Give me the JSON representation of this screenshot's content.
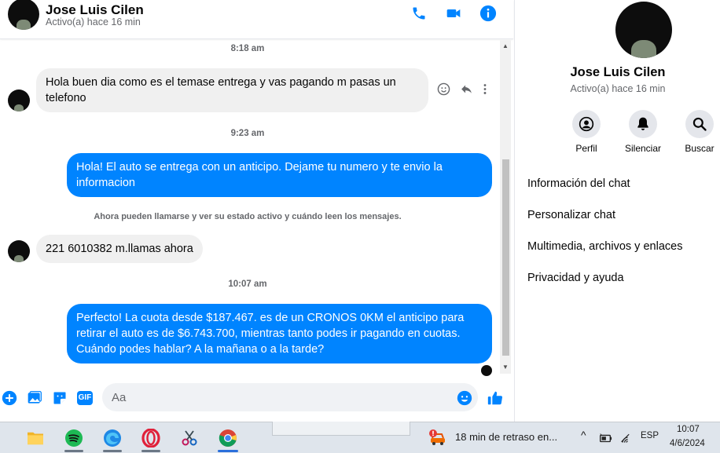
{
  "header": {
    "contact_name": "Jose Luis Cilen",
    "status": "Activo(a) hace 16 min",
    "icons": [
      "phone-icon",
      "video-icon",
      "info-icon"
    ]
  },
  "messages": {
    "ts1": "8:18 am",
    "msg1": "Hola buen dia como es el temase entrega y vas pagando m pasas un telefono",
    "ts2": "9:23 am",
    "msg2": "Hola! El auto se entrega con un anticipo. Dejame tu numero y te envio la informacion",
    "notice": "Ahora pueden llamarse y ver su estado activo y cuándo leen los mensajes.",
    "msg3": "221 6010382  m.llamas ahora",
    "ts3": "10:07 am",
    "msg4": "Perfecto! La cuota desde $187.467. es de un CRONOS 0KM el anticipo para retirar el auto es de $6.743.700, mientras tanto podes ir pagando en cuotas. Cuándo podes hablar? A la mañana o a la tarde?"
  },
  "composer": {
    "placeholder": "Aa",
    "gif_label": "GIF"
  },
  "right_panel": {
    "name": "Jose Luis Cilen",
    "status": "Activo(a) hace 16 min",
    "actions": [
      {
        "label": "Perfil",
        "icon": "profile-icon"
      },
      {
        "label": "Silenciar",
        "icon": "bell-icon"
      },
      {
        "label": "Buscar",
        "icon": "search-icon"
      }
    ],
    "menu": [
      "Información del chat",
      "Personalizar chat",
      "Multimedia, archivos y enlaces",
      "Privacidad y ayuda"
    ]
  },
  "taskbar": {
    "notification": "18 min de retraso en...",
    "language": "ESP",
    "time": "10:07",
    "date": "4/6/2024"
  },
  "colors": {
    "accent": "#0084ff",
    "incoming_bubble": "#f0f0f0",
    "taskbar": "#dfe5ec"
  }
}
